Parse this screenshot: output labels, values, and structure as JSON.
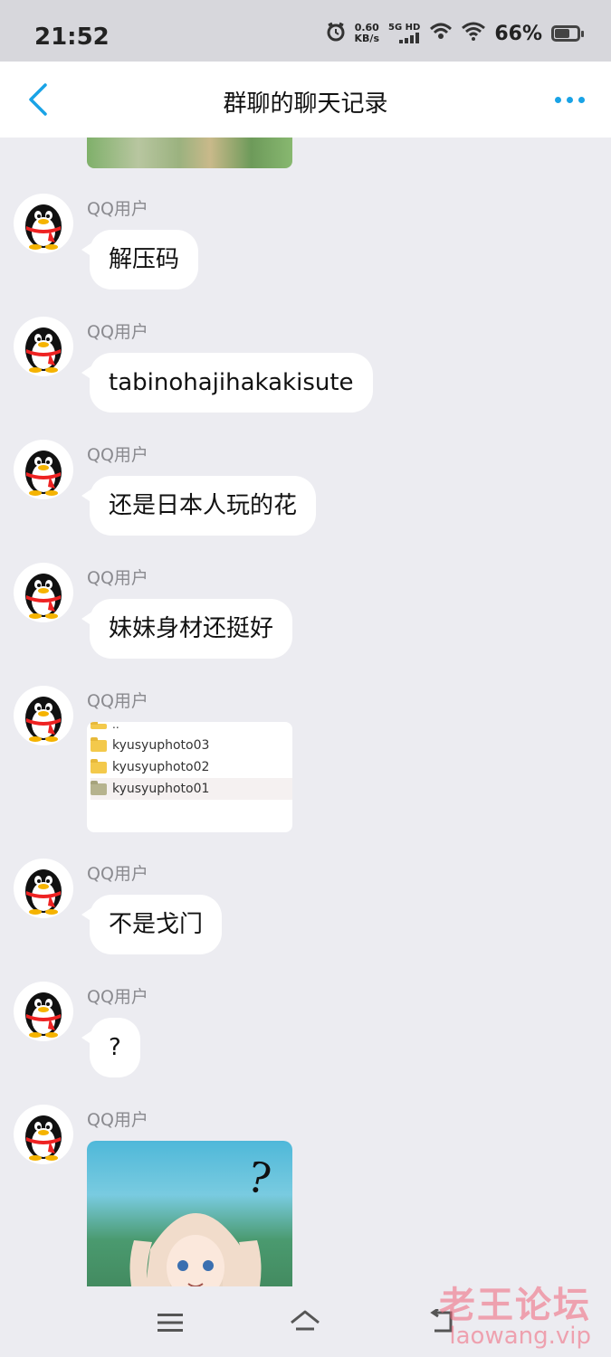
{
  "status_bar": {
    "time": "21:52",
    "net_speed": "0.60",
    "net_unit": "KB/s",
    "signal_label": "5G HD",
    "battery": "66%"
  },
  "header": {
    "title": "群聊的聊天记录"
  },
  "messages": [
    {
      "user": "QQ用户",
      "type": "text",
      "text": "解压码"
    },
    {
      "user": "QQ用户",
      "type": "text",
      "text": "tabinohajihakakisute"
    },
    {
      "user": "QQ用户",
      "type": "text",
      "text": "还是日本人玩的花"
    },
    {
      "user": "QQ用户",
      "type": "text",
      "text": "妹妹身材还挺好"
    },
    {
      "user": "QQ用户",
      "type": "image_files",
      "files": [
        "..",
        "kyusyuphoto03",
        "kyusyuphoto02",
        "kyusyuphoto01"
      ]
    },
    {
      "user": "QQ用户",
      "type": "text",
      "text": "不是戈门"
    },
    {
      "user": "QQ用户",
      "type": "text",
      "text": "?"
    },
    {
      "user": "QQ用户",
      "type": "image"
    }
  ],
  "anime_question": "?",
  "watermark": {
    "cn": "老王论坛",
    "url": "laowang.vip"
  },
  "colors": {
    "accent": "#19a3e6",
    "background": "#ececf1",
    "bubble": "#ffffff"
  }
}
